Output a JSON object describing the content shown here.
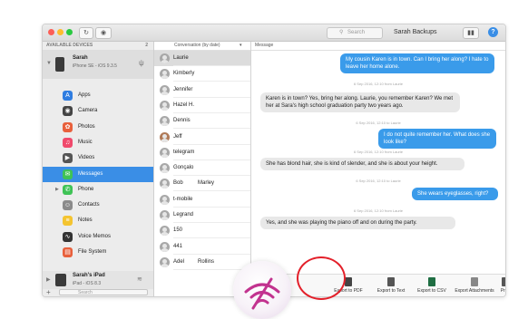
{
  "window": {
    "backup_name": "Sarah Backups",
    "search_placeholder": "Search",
    "help_label": "?",
    "columns_btn": "◫",
    "eye_btn": "◉",
    "refresh_btn": "↻",
    "view_btn": "▮▮"
  },
  "sidebar": {
    "header": "AVAILABLE DEVICES",
    "device_count": "2",
    "device": {
      "name": "Sarah",
      "subtitle": "iPhone SE - iOS 9.3.5"
    },
    "items": [
      {
        "label": "Apps",
        "icon": "apps-icon",
        "color": "#2f7de1"
      },
      {
        "label": "Camera",
        "icon": "camera-icon",
        "color": "#444444"
      },
      {
        "label": "Photos",
        "icon": "photos-icon",
        "color": "#e8603c"
      },
      {
        "label": "Music",
        "icon": "music-icon",
        "color": "#f04a6c"
      },
      {
        "label": "Videos",
        "icon": "videos-icon",
        "color": "#555555"
      },
      {
        "label": "Messages",
        "icon": "messages-icon",
        "color": "#3fc356",
        "selected": true
      },
      {
        "label": "Phone",
        "icon": "phone-icon",
        "color": "#3fc356"
      },
      {
        "label": "Contacts",
        "icon": "contacts-icon",
        "color": "#8a8a8a"
      },
      {
        "label": "Notes",
        "icon": "notes-icon",
        "color": "#f4c430"
      },
      {
        "label": "Voice Memos",
        "icon": "voice-memos-icon",
        "color": "#333333"
      },
      {
        "label": "File System",
        "icon": "file-system-icon",
        "color": "#e8603c"
      }
    ],
    "ipad": {
      "name": "Sarah's iPad",
      "subtitle": "iPad - iOS 8.3"
    },
    "add_label": "+",
    "search_placeholder": "Search"
  },
  "conversations": {
    "header": "Conversation (by date)",
    "rows": [
      {
        "name": "Laurie",
        "extra": "",
        "selected": true
      },
      {
        "name": "Kimberly",
        "extra": ""
      },
      {
        "name": "Jennifer",
        "extra": ""
      },
      {
        "name": "Hazel H.",
        "extra": ""
      },
      {
        "name": "Dennis",
        "extra": ""
      },
      {
        "name": "Jeff",
        "extra": "",
        "photo": true
      },
      {
        "name": "telegram",
        "extra": ""
      },
      {
        "name": "Gonçalo",
        "extra": ""
      },
      {
        "name": "Bob",
        "extra": "Marley"
      },
      {
        "name": "t-mobile",
        "extra": ""
      },
      {
        "name": "Legrand",
        "extra": ""
      },
      {
        "name": "150",
        "extra": ""
      },
      {
        "name": "441",
        "extra": ""
      },
      {
        "name": "Adel",
        "extra": "Rollins"
      }
    ]
  },
  "messages": {
    "header": "Message",
    "items": [
      {
        "type": "out",
        "text": "My cousin Karen is in town. Can I bring her along? I hate to leave her home alone."
      },
      {
        "type": "ts",
        "text": "6 Sep 2016, 12:10 from Laurie"
      },
      {
        "type": "in",
        "text": "Karen is in town? Yes, bring her along. Laurie, you remember Karen? We met her at Sara's high school graduation party two years ago."
      },
      {
        "type": "ts",
        "text": "6 Sep 2016, 12:10 to Laurie"
      },
      {
        "type": "out",
        "text": "I do not quite remember her. What does she look like?"
      },
      {
        "type": "ts",
        "text": "6 Sep 2016, 12:10 from Laurie"
      },
      {
        "type": "in",
        "text": "She has blond hair, she is kind of slender, and she is about your height."
      },
      {
        "type": "ts",
        "text": "6 Sep 2016, 12:10 to Laurie"
      },
      {
        "type": "out",
        "text": "She wears eyeglasses, right?"
      },
      {
        "type": "ts",
        "text": "6 Sep 2016, 12:10 from Laurie"
      },
      {
        "type": "in",
        "text": "Yes, and she was playing the piano off and on during the party."
      }
    ]
  },
  "toolbar": {
    "items": [
      {
        "label": "Export to PDF",
        "icon": "pdf-icon",
        "color": "#444444"
      },
      {
        "label": "Export to Text",
        "icon": "text-icon",
        "color": "#555555"
      },
      {
        "label": "Export to CSV",
        "icon": "csv-icon",
        "color": "#1f6e43"
      },
      {
        "label": "Export Attachments",
        "icon": "paperclip-icon",
        "color": "#888888"
      },
      {
        "label": "Print",
        "icon": "printer-icon",
        "color": "#555555"
      }
    ]
  },
  "colors": {
    "accent": "#3a8ee6",
    "bubble_out": "#3a9bea",
    "bubble_in": "#e8e8e8",
    "highlight": "#e3202a",
    "logo": "#c2338f"
  }
}
